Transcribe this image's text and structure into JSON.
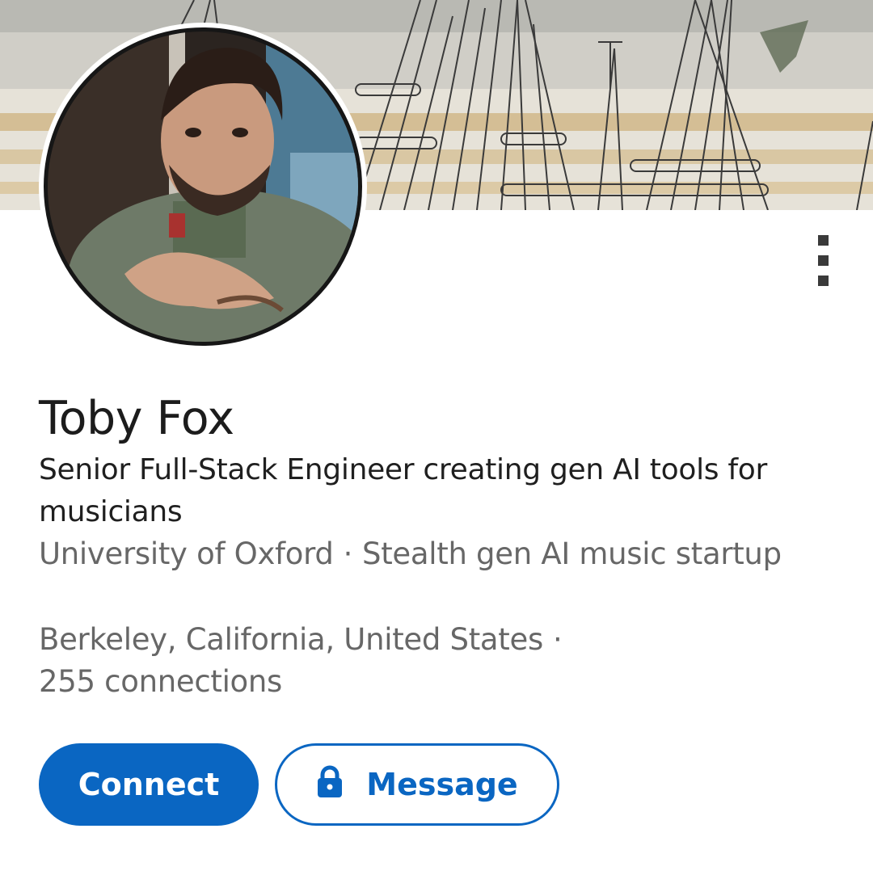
{
  "profile": {
    "name": "Toby Fox",
    "headline": "Senior Full-Stack Engineer creating gen AI tools for musicians",
    "education": "University of Oxford",
    "company": "Stealth gen AI music startup",
    "location": "Berkeley, California, United States",
    "connections": "255 connections",
    "separator": "·"
  },
  "actions": {
    "connect_label": "Connect",
    "message_label": "Message"
  },
  "icons": {
    "more": "more-vertical-icon",
    "lock": "lock-icon"
  },
  "colors": {
    "brand_blue": "#0a66c2",
    "text_primary": "#1c1c1c",
    "text_secondary": "#676767"
  }
}
